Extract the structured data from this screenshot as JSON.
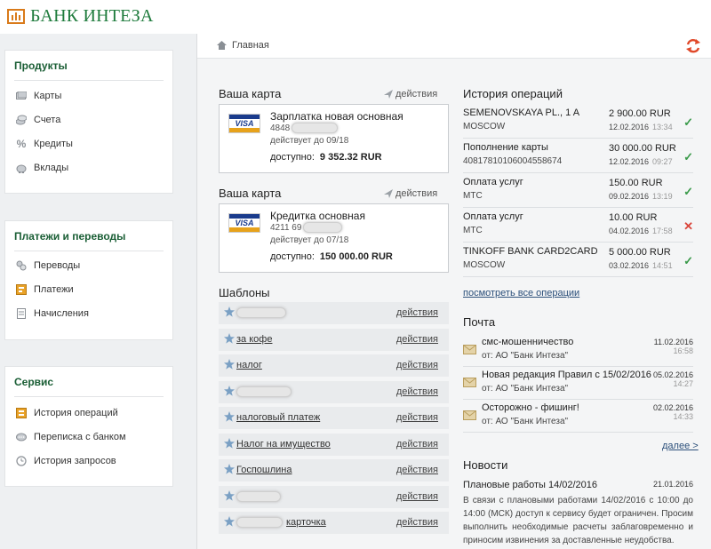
{
  "brand": {
    "name": "БАНК ИНТЕЗА",
    "color": "#1e7b3c",
    "accent": "#d97a1a"
  },
  "sidebar": {
    "products": {
      "title": "Продукты",
      "items": [
        {
          "label": "Карты",
          "icon": "cards-icon"
        },
        {
          "label": "Счета",
          "icon": "coins-icon"
        },
        {
          "label": "Кредиты",
          "icon": "percent-icon"
        },
        {
          "label": "Вклады",
          "icon": "piggy-bank-icon"
        }
      ]
    },
    "payments": {
      "title": "Платежи и переводы",
      "items": [
        {
          "label": "Переводы",
          "icon": "transfer-icon"
        },
        {
          "label": "Платежи",
          "icon": "payment-icon"
        },
        {
          "label": "Начисления",
          "icon": "accrual-icon"
        }
      ]
    },
    "service": {
      "title": "Сервис",
      "items": [
        {
          "label": "История операций",
          "icon": "history-icon"
        },
        {
          "label": "Переписка с банком",
          "icon": "chat-icon"
        },
        {
          "label": "История запросов",
          "icon": "clock-icon"
        }
      ]
    }
  },
  "breadcrumb": {
    "home": "Главная"
  },
  "cards_section": {
    "title": "Ваша карта",
    "actions_label": "действия",
    "available_label": "доступно:",
    "cards": [
      {
        "brand": "VISA",
        "name": "Зарплатка новая  основная",
        "number_prefix": "4848",
        "valid": "действует до 09/18",
        "balance": "9 352.32 RUR"
      },
      {
        "brand": "VISA",
        "name": "Кредитка  основная",
        "number_prefix": "4211 69",
        "valid": "действует до 07/18",
        "balance": "150 000.00 RUR"
      }
    ]
  },
  "templates": {
    "title": "Шаблоны",
    "action_label": "действия",
    "items": [
      {
        "name": ""
      },
      {
        "name": "за кофе"
      },
      {
        "name": "налог"
      },
      {
        "name": ""
      },
      {
        "name": "налоговый платеж"
      },
      {
        "name": "Налог на имущество"
      },
      {
        "name": "Госпошлина"
      },
      {
        "name": ""
      },
      {
        "name": "карточка"
      }
    ]
  },
  "history": {
    "title": "История операций",
    "view_all": "посмотреть все операции",
    "items": [
      {
        "title": "SEMENOVSKAYA PL., 1 A",
        "sub": "MOSCOW",
        "amount": "2 900.00 RUR",
        "date": "12.02.2016",
        "time": "13:34",
        "status": "ok"
      },
      {
        "title": "Пополнение карты",
        "sub": "40817810106004558674",
        "amount": "30 000.00 RUR",
        "date": "12.02.2016",
        "time": "09:27",
        "status": "ok"
      },
      {
        "title": "Оплата услуг",
        "sub": "МТС",
        "amount": "150.00 RUR",
        "date": "09.02.2016",
        "time": "13:19",
        "status": "ok"
      },
      {
        "title": "Оплата услуг",
        "sub": "МТС",
        "amount": "10.00 RUR",
        "date": "04.02.2016",
        "time": "17:58",
        "status": "fail"
      },
      {
        "title": "TINKOFF BANK CARD2CARD",
        "sub": "MOSCOW",
        "amount": "5 000.00 RUR",
        "date": "03.02.2016",
        "time": "14:51",
        "status": "ok"
      }
    ],
    "status_colors": {
      "ok": "#3a9a4a",
      "fail": "#d9443a"
    }
  },
  "mail": {
    "title": "Почта",
    "more": "далее >",
    "items": [
      {
        "subject": "смс-мошенничество",
        "from": "от: АО \"Банк Интеза\"",
        "date": "11.02.2016",
        "time": "16:58"
      },
      {
        "subject": "Новая редакция Правил с 15/02/2016",
        "from": "от: АО \"Банк Интеза\"",
        "date": "05.02.2016",
        "time": "14:27"
      },
      {
        "subject": "Осторожно - фишинг!",
        "from": "от: АО \"Банк Интеза\"",
        "date": "02.02.2016",
        "time": "14:33"
      }
    ]
  },
  "news": {
    "title": "Новости",
    "item": {
      "title": "Плановые работы 14/02/2016",
      "date": "21.01.2016",
      "text": "В связи с плановыми работами 14/02/2016 с 10:00 до 14:00 (МСК) доступ к сервису будет ограничен. Просим выполнить необходимые расчеты заблаговременно и приносим извинения за доставленные неудобства."
    }
  }
}
